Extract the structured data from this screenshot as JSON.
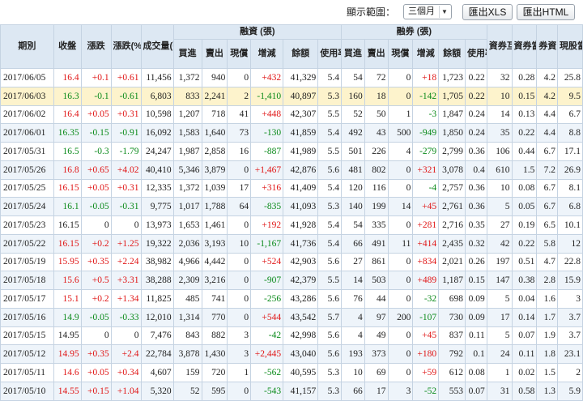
{
  "toolbar": {
    "range_label": "顯示範圍：",
    "range_value": "三個月",
    "export_xls": "匯出XLS",
    "export_html": "匯出HTML"
  },
  "headers": {
    "date": "期別",
    "close": "收盤",
    "change": "漲跌",
    "change_pct": "漲跌(%)",
    "volume": "成交量(張)",
    "margin_group": "融資 (張)",
    "short_group": "融券 (張)",
    "m_buy": "買進",
    "m_sell": "賣出",
    "m_cash": "現償",
    "m_diff": "增減",
    "m_balance": "餘額",
    "m_usage": "使用率%",
    "s_buy": "買進",
    "s_sell": "賣出",
    "s_cash": "現償",
    "s_diff": "增減",
    "s_balance": "餘額",
    "s_usage": "使用率%",
    "offset": "資券互抵(張)",
    "offset_pct": "資券當沖(%)",
    "ratio": "券資比(%)",
    "daytrade": "現股當沖(%)"
  },
  "colors": {
    "up": "#e01616",
    "down": "#0a8a1a",
    "highlight_row": "#fdf3cc"
  },
  "rows": [
    {
      "date": "2017/06/05",
      "close": "16.4",
      "chg": "+0.1",
      "pct": "+0.61",
      "vol": "11,456",
      "mb": "1,372",
      "ms": "940",
      "mc": "0",
      "md": "+432",
      "mbal": "41,329",
      "mu": "5.4",
      "sb": "54",
      "ss": "72",
      "sc": "0",
      "sd": "+18",
      "sbal": "1,723",
      "su": "0.22",
      "off": "32",
      "offp": "0.28",
      "ratio": "4.2",
      "dt": "25.8",
      "dir": "up"
    },
    {
      "date": "2017/06/03",
      "close": "16.3",
      "chg": "-0.1",
      "pct": "-0.61",
      "vol": "6,803",
      "mb": "833",
      "ms": "2,241",
      "mc": "2",
      "md": "-1,410",
      "mbal": "40,897",
      "mu": "5.3",
      "sb": "160",
      "ss": "18",
      "sc": "0",
      "sd": "-142",
      "sbal": "1,705",
      "su": "0.22",
      "off": "10",
      "offp": "0.15",
      "ratio": "4.2",
      "dt": "9.5",
      "dir": "down"
    },
    {
      "date": "2017/06/02",
      "close": "16.4",
      "chg": "+0.05",
      "pct": "+0.31",
      "vol": "10,598",
      "mb": "1,207",
      "ms": "718",
      "mc": "41",
      "md": "+448",
      "mbal": "42,307",
      "mu": "5.5",
      "sb": "52",
      "ss": "50",
      "sc": "1",
      "sd": "-3",
      "sbal": "1,847",
      "su": "0.24",
      "off": "14",
      "offp": "0.13",
      "ratio": "4.4",
      "dt": "6.7",
      "dir": "up"
    },
    {
      "date": "2017/06/01",
      "close": "16.35",
      "chg": "-0.15",
      "pct": "-0.91",
      "vol": "16,092",
      "mb": "1,583",
      "ms": "1,640",
      "mc": "73",
      "md": "-130",
      "mbal": "41,859",
      "mu": "5.4",
      "sb": "492",
      "ss": "43",
      "sc": "500",
      "sd": "-949",
      "sbal": "1,850",
      "su": "0.24",
      "off": "35",
      "offp": "0.22",
      "ratio": "4.4",
      "dt": "8.8",
      "dir": "down"
    },
    {
      "date": "2017/05/31",
      "close": "16.5",
      "chg": "-0.3",
      "pct": "-1.79",
      "vol": "24,247",
      "mb": "1,987",
      "ms": "2,858",
      "mc": "16",
      "md": "-887",
      "mbal": "41,989",
      "mu": "5.5",
      "sb": "501",
      "ss": "226",
      "sc": "4",
      "sd": "-279",
      "sbal": "2,799",
      "su": "0.36",
      "off": "106",
      "offp": "0.44",
      "ratio": "6.7",
      "dt": "17.1",
      "dir": "down"
    },
    {
      "date": "2017/05/26",
      "close": "16.8",
      "chg": "+0.65",
      "pct": "+4.02",
      "vol": "40,410",
      "mb": "5,346",
      "ms": "3,879",
      "mc": "0",
      "md": "+1,467",
      "mbal": "42,876",
      "mu": "5.6",
      "sb": "481",
      "ss": "802",
      "sc": "0",
      "sd": "+321",
      "sbal": "3,078",
      "su": "0.4",
      "off": "610",
      "offp": "1.5",
      "ratio": "7.2",
      "dt": "26.9",
      "dir": "up"
    },
    {
      "date": "2017/05/25",
      "close": "16.15",
      "chg": "+0.05",
      "pct": "+0.31",
      "vol": "12,335",
      "mb": "1,372",
      "ms": "1,039",
      "mc": "17",
      "md": "+316",
      "mbal": "41,409",
      "mu": "5.4",
      "sb": "120",
      "ss": "116",
      "sc": "0",
      "sd": "-4",
      "sbal": "2,757",
      "su": "0.36",
      "off": "10",
      "offp": "0.08",
      "ratio": "6.7",
      "dt": "8.1",
      "dir": "up"
    },
    {
      "date": "2017/05/24",
      "close": "16.1",
      "chg": "-0.05",
      "pct": "-0.31",
      "vol": "9,775",
      "mb": "1,017",
      "ms": "1,788",
      "mc": "64",
      "md": "-835",
      "mbal": "41,093",
      "mu": "5.3",
      "sb": "140",
      "ss": "199",
      "sc": "14",
      "sd": "+45",
      "sbal": "2,761",
      "su": "0.36",
      "off": "5",
      "offp": "0.05",
      "ratio": "6.7",
      "dt": "6.8",
      "dir": "down"
    },
    {
      "date": "2017/05/23",
      "close": "16.15",
      "chg": "0",
      "pct": "0",
      "vol": "13,973",
      "mb": "1,653",
      "ms": "1,461",
      "mc": "0",
      "md": "+192",
      "mbal": "41,928",
      "mu": "5.4",
      "sb": "54",
      "ss": "335",
      "sc": "0",
      "sd": "+281",
      "sbal": "2,716",
      "su": "0.35",
      "off": "27",
      "offp": "0.19",
      "ratio": "6.5",
      "dt": "10.1",
      "dir": "flat"
    },
    {
      "date": "2017/05/22",
      "close": "16.15",
      "chg": "+0.2",
      "pct": "+1.25",
      "vol": "19,322",
      "mb": "2,036",
      "ms": "3,193",
      "mc": "10",
      "md": "-1,167",
      "mbal": "41,736",
      "mu": "5.4",
      "sb": "66",
      "ss": "491",
      "sc": "11",
      "sd": "+414",
      "sbal": "2,435",
      "su": "0.32",
      "off": "42",
      "offp": "0.22",
      "ratio": "5.8",
      "dt": "12",
      "dir": "up"
    },
    {
      "date": "2017/05/19",
      "close": "15.95",
      "chg": "+0.35",
      "pct": "+2.24",
      "vol": "38,982",
      "mb": "4,966",
      "ms": "4,442",
      "mc": "0",
      "md": "+524",
      "mbal": "42,903",
      "mu": "5.6",
      "sb": "27",
      "ss": "861",
      "sc": "0",
      "sd": "+834",
      "sbal": "2,021",
      "su": "0.26",
      "off": "197",
      "offp": "0.51",
      "ratio": "4.7",
      "dt": "22.8",
      "dir": "up"
    },
    {
      "date": "2017/05/18",
      "close": "15.6",
      "chg": "+0.5",
      "pct": "+3.31",
      "vol": "38,288",
      "mb": "2,309",
      "ms": "3,216",
      "mc": "0",
      "md": "-907",
      "mbal": "42,379",
      "mu": "5.5",
      "sb": "14",
      "ss": "503",
      "sc": "0",
      "sd": "+489",
      "sbal": "1,187",
      "su": "0.15",
      "off": "147",
      "offp": "0.38",
      "ratio": "2.8",
      "dt": "15.9",
      "dir": "up"
    },
    {
      "date": "2017/05/17",
      "close": "15.1",
      "chg": "+0.2",
      "pct": "+1.34",
      "vol": "11,825",
      "mb": "485",
      "ms": "741",
      "mc": "0",
      "md": "-256",
      "mbal": "43,286",
      "mu": "5.6",
      "sb": "76",
      "ss": "44",
      "sc": "0",
      "sd": "-32",
      "sbal": "698",
      "su": "0.09",
      "off": "5",
      "offp": "0.04",
      "ratio": "1.6",
      "dt": "3",
      "dir": "up"
    },
    {
      "date": "2017/05/16",
      "close": "14.9",
      "chg": "-0.05",
      "pct": "-0.33",
      "vol": "12,010",
      "mb": "1,314",
      "ms": "770",
      "mc": "0",
      "md": "+544",
      "mbal": "43,542",
      "mu": "5.7",
      "sb": "4",
      "ss": "97",
      "sc": "200",
      "sd": "-107",
      "sbal": "730",
      "su": "0.09",
      "off": "17",
      "offp": "0.14",
      "ratio": "1.7",
      "dt": "3.7",
      "dir": "down"
    },
    {
      "date": "2017/05/15",
      "close": "14.95",
      "chg": "0",
      "pct": "0",
      "vol": "7,476",
      "mb": "843",
      "ms": "882",
      "mc": "3",
      "md": "-42",
      "mbal": "42,998",
      "mu": "5.6",
      "sb": "4",
      "ss": "49",
      "sc": "0",
      "sd": "+45",
      "sbal": "837",
      "su": "0.11",
      "off": "5",
      "offp": "0.07",
      "ratio": "1.9",
      "dt": "3.7",
      "dir": "flat"
    },
    {
      "date": "2017/05/12",
      "close": "14.95",
      "chg": "+0.35",
      "pct": "+2.4",
      "vol": "22,784",
      "mb": "3,878",
      "ms": "1,430",
      "mc": "3",
      "md": "+2,445",
      "mbal": "43,040",
      "mu": "5.6",
      "sb": "193",
      "ss": "373",
      "sc": "0",
      "sd": "+180",
      "sbal": "792",
      "su": "0.1",
      "off": "24",
      "offp": "0.11",
      "ratio": "1.8",
      "dt": "23.1",
      "dir": "up"
    },
    {
      "date": "2017/05/11",
      "close": "14.6",
      "chg": "+0.05",
      "pct": "+0.34",
      "vol": "4,607",
      "mb": "159",
      "ms": "720",
      "mc": "1",
      "md": "-562",
      "mbal": "40,595",
      "mu": "5.3",
      "sb": "10",
      "ss": "69",
      "sc": "0",
      "sd": "+59",
      "sbal": "612",
      "su": "0.08",
      "off": "1",
      "offp": "0.02",
      "ratio": "1.5",
      "dt": "2",
      "dir": "up"
    },
    {
      "date": "2017/05/10",
      "close": "14.55",
      "chg": "+0.15",
      "pct": "+1.04",
      "vol": "5,320",
      "mb": "52",
      "ms": "595",
      "mc": "0",
      "md": "-543",
      "mbal": "41,157",
      "mu": "5.3",
      "sb": "66",
      "ss": "17",
      "sc": "3",
      "sd": "-52",
      "sbal": "553",
      "su": "0.07",
      "off": "31",
      "offp": "0.58",
      "ratio": "1.3",
      "dt": "5.9",
      "dir": "up"
    }
  ]
}
